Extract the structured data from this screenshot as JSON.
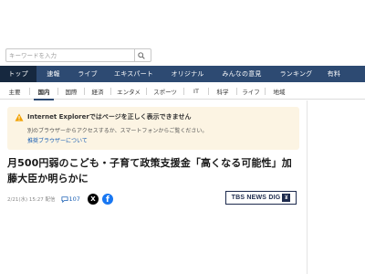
{
  "search": {
    "placeholder": "キーワードを入力",
    "button_icon": "search-icon"
  },
  "main_nav": {
    "items": [
      {
        "label": "トップ",
        "active": true
      },
      {
        "label": "速報",
        "active": false
      },
      {
        "label": "ライブ",
        "active": false
      },
      {
        "label": "エキスパート",
        "active": false
      },
      {
        "label": "オリジナル",
        "active": false
      },
      {
        "label": "みんなの意見",
        "active": false
      },
      {
        "label": "ランキング",
        "active": false
      },
      {
        "label": "有料",
        "active": false
      }
    ],
    "background": "#2d4a72",
    "active_background": "#16283f"
  },
  "sub_nav": {
    "items": [
      {
        "label": "主要",
        "active": false
      },
      {
        "label": "国内",
        "active": true
      },
      {
        "label": "国際",
        "active": false
      },
      {
        "label": "経済",
        "active": false
      },
      {
        "label": "エンタメ",
        "active": false
      },
      {
        "label": "スポーツ",
        "active": false
      },
      {
        "label": "IT",
        "active": false
      },
      {
        "label": "科学",
        "active": false
      },
      {
        "label": "ライフ",
        "active": false
      },
      {
        "label": "地域",
        "active": false
      }
    ]
  },
  "ie_warning": {
    "icon": "warning-icon",
    "title": "Internet Explorerではページを正しく表示できません",
    "body": "別のブラウザーからアクセスするか、スマートフォンからご覧ください。",
    "link": "推奨ブラウザーについて",
    "background": "#fcf4e3"
  },
  "article": {
    "headline": "月500円弱のこども・子育て政策支援金「高くなる可能性」加藤大臣か明らかに",
    "timestamp": "2/21(水) 15:27 配信",
    "comment_count": "107",
    "share": {
      "x_label": "X",
      "facebook_label": "f"
    }
  },
  "source": {
    "logo_text": "TBS NEWS DIG",
    "logo_badge": "¥"
  }
}
